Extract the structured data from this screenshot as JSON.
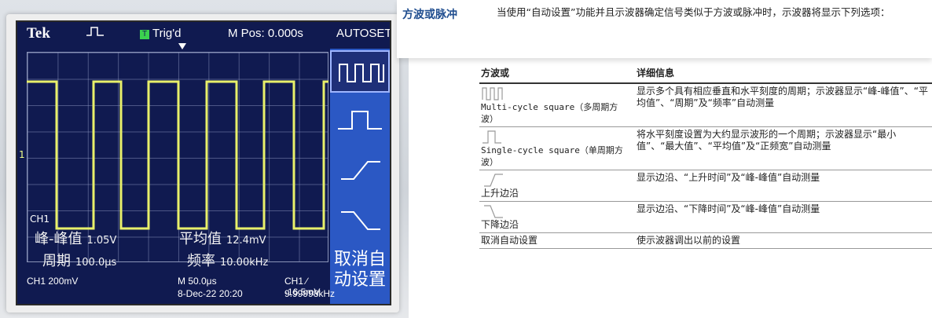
{
  "scope": {
    "brand": "Tek",
    "pulse_icon": "pulse-icon",
    "trig_indicator": "T",
    "trig_status": "Trig'd",
    "m_pos": "M Pos: 0.000s",
    "mode": "AUTOSET",
    "ch1_label": "CH1",
    "ch1_marker": "1",
    "measurements": {
      "vpp_label": "峰-峰值",
      "vpp_value": "1.05V",
      "mean_label": "平均值",
      "mean_value": "12.4mV",
      "period_label": "周期",
      "period_value": "100.0μs",
      "freq_label": "频率",
      "freq_value": "10.00kHz"
    },
    "menu": {
      "items": [
        "multi-cycle-square-icon",
        "single-cycle-square-icon",
        "rising-edge-icon",
        "falling-edge-icon"
      ],
      "cancel_line1": "取消自",
      "cancel_line2": "动设置"
    },
    "bottom": {
      "ch1_scale": "CH1  200mV",
      "timebase": "M 50.0μs",
      "date": "8-Dec-22 20:20",
      "trigger": "CH1 ∕ -16.5mV",
      "freq": "9.99998kHz"
    },
    "colors": {
      "screen": "#101a50",
      "trace": "#e8f06a",
      "menu": "#2b58c4"
    }
  },
  "doc": {
    "section_title": "方波或脉冲",
    "section_desc": "当使用“自动设置”功能并且示波器确定信号类似于方波或脉冲时，示波器将显示下列选项：",
    "table": {
      "headers": [
        "方波或",
        "详细信息"
      ],
      "rows": [
        {
          "icon": "multi-cycle-square-icon",
          "name": "Multi-cycle square（多周期方波）",
          "detail": "显示多个具有相应垂直和水平刻度的周期；示波器显示“峰-峰值”、“平均值”、“周期”及“频率”自动测量"
        },
        {
          "icon": "single-cycle-square-icon",
          "name": "Single-cycle square（单周期方波）",
          "detail": "将水平刻度设置为大约显示波形的一个周期；示波器显示“最小值”、“最大值”、“平均值”及“正频宽”自动测量"
        },
        {
          "icon": "rising-edge-icon",
          "name": "上升边沿",
          "detail": "显示边沿、“上升时间”及“峰-峰值”自动测量"
        },
        {
          "icon": "falling-edge-icon",
          "name": "下降边沿",
          "detail": "显示边沿、“下降时间”及“峰-峰值”自动测量"
        },
        {
          "icon": "",
          "name": "取消自动设置",
          "detail": "使示波器调出以前的设置"
        }
      ]
    }
  }
}
